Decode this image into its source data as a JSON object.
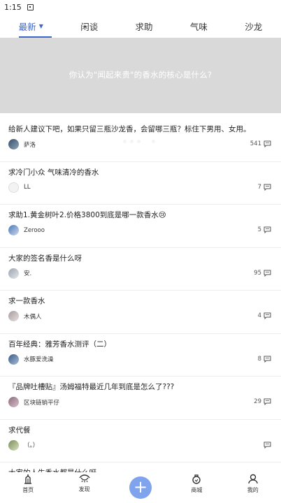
{
  "status_bar": {
    "time": "1:15"
  },
  "tabs": [
    {
      "label": "最新",
      "active": true,
      "has_dropdown": true
    },
    {
      "label": "闲谈"
    },
    {
      "label": "求助"
    },
    {
      "label": "气味"
    },
    {
      "label": "沙龙"
    }
  ],
  "banner": {
    "text": "你认为\"闻起来贵\"的香水的核心是什么?",
    "dots_total": 5,
    "active_dot": 4
  },
  "posts": [
    {
      "title": "给新人建议下吧，如果只留三瓶沙龙香，会留哪三瓶？标住下男用、女用。",
      "author": "萨洛",
      "count": "541"
    },
    {
      "title": "求冷门小众 气味清冷的香水",
      "author": "LL",
      "count": "7"
    },
    {
      "title": "求助1.黄金树叶2.价格3800到底是哪一款香水😢",
      "author": "Zerooo",
      "count": "5"
    },
    {
      "title": "大家的签名香是什么呀",
      "author": "安.",
      "count": "95"
    },
    {
      "title": "求一款香水",
      "author": "木偶人",
      "count": "4"
    },
    {
      "title": "百年经典：雅芳香水测评（二）",
      "author": "水豚爱洗澡",
      "count": "8"
    },
    {
      "title": "『品牌吐槽贴』汤姆福特最近几年到底是怎么了???",
      "author": "区块链销平仔",
      "count": "29"
    },
    {
      "title": "求代餐",
      "author": "（。）",
      "count": ""
    },
    {
      "title": "大家的人生香水都是什么呀",
      "author": "",
      "count": ""
    }
  ],
  "bottom_nav": [
    {
      "label": "首页",
      "icon": "home-icon"
    },
    {
      "label": "发现",
      "icon": "eye-icon"
    },
    {
      "label": "",
      "icon": "plus-icon"
    },
    {
      "label": "商城",
      "icon": "bag-icon"
    },
    {
      "label": "我的",
      "icon": "person-icon"
    }
  ],
  "colors": {
    "accent": "#3c66c8",
    "fab": "#7fa3ec",
    "banner_bg": "#d9d9d9"
  }
}
